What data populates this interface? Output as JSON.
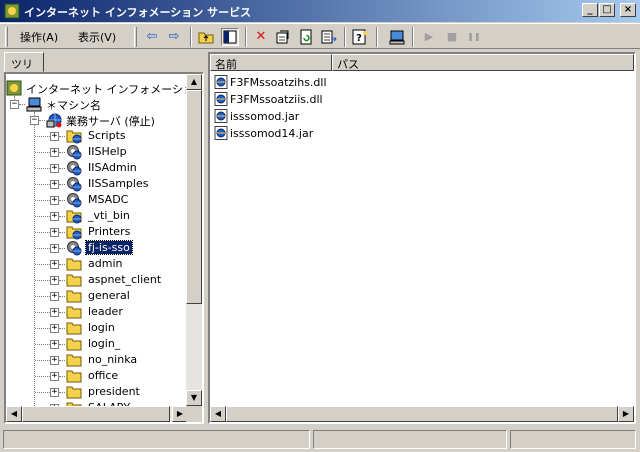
{
  "window": {
    "title": "インターネット インフォメーション サービス",
    "minimize_glyph": "_",
    "maximize_glyph": "□",
    "close_glyph": "×"
  },
  "menu": {
    "action": "操作(A)",
    "view": "表示(V)"
  },
  "toolbar": {
    "back_glyph": "⇦",
    "forward_glyph": "⇨",
    "delete_glyph": "✕",
    "play_glyph": "▶",
    "stop_glyph": "■",
    "pause_glyph": "❚❚"
  },
  "tree_tab": "ツリー",
  "tree": {
    "root": "インターネット インフォメーション サービス",
    "machine": "＊マシン名",
    "site": "業務サーバ (停止)",
    "expand_glyph": "+",
    "collapse_glyph": "−",
    "children": [
      {
        "label": "Scripts",
        "icon": "folder-globe"
      },
      {
        "label": "IISHelp",
        "icon": "gear-globe"
      },
      {
        "label": "IISAdmin",
        "icon": "gear-globe"
      },
      {
        "label": "IISSamples",
        "icon": "gear-globe"
      },
      {
        "label": "MSADC",
        "icon": "gear-globe"
      },
      {
        "label": "_vti_bin",
        "icon": "folder-globe"
      },
      {
        "label": "Printers",
        "icon": "folder-globe"
      },
      {
        "label": "fj-is-sso",
        "icon": "gear-globe",
        "selected": true
      },
      {
        "label": "admin",
        "icon": "folder"
      },
      {
        "label": "aspnet_client",
        "icon": "folder"
      },
      {
        "label": "general",
        "icon": "folder"
      },
      {
        "label": "leader",
        "icon": "folder"
      },
      {
        "label": "login",
        "icon": "folder"
      },
      {
        "label": "login_",
        "icon": "folder"
      },
      {
        "label": "no_ninka",
        "icon": "folder"
      },
      {
        "label": "office",
        "icon": "folder"
      },
      {
        "label": "president",
        "icon": "folder"
      },
      {
        "label": "SALARY",
        "icon": "folder"
      }
    ]
  },
  "list": {
    "columns": [
      "名前",
      "パス"
    ],
    "items": [
      {
        "name": "F3FMssoatzihs.dll"
      },
      {
        "name": "F3FMssoatziis.dll"
      },
      {
        "name": "isssomod.jar"
      },
      {
        "name": "isssomod14.jar"
      }
    ]
  },
  "scroll": {
    "up": "▲",
    "down": "▼",
    "left": "◀",
    "right": "▶"
  },
  "colors": {
    "title_start": "#0a246a",
    "title_end": "#a6caf0",
    "face": "#d4d0c8",
    "selection": "#0a246a",
    "folder": "#f2d24a",
    "globe": "#1b5fc4",
    "delete": "#e01010"
  }
}
